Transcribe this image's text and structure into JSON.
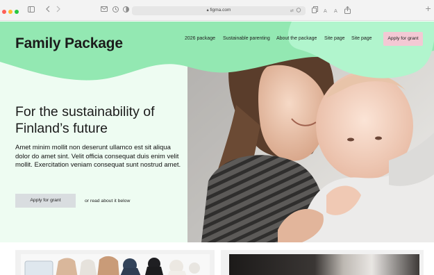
{
  "browser": {
    "url": "figma.com",
    "toolbar_icons": [
      "sidebar-icon",
      "back-icon",
      "forward-icon",
      "mail-icon",
      "history-icon",
      "shield-icon",
      "translate-icon",
      "copy-icon",
      "text-size-icon",
      "share-icon",
      "new-tab-icon"
    ],
    "text_small": "A",
    "text_large": "A",
    "new_tab": "+"
  },
  "site": {
    "logo": "Family Package",
    "nav": [
      "2026 package",
      "Sustainable parenting",
      "About the package",
      "Site page",
      "Site page"
    ],
    "apply_top": "Apply for grant",
    "headline": "For the sustainability of Finland’s future",
    "body": "Amet minim mollit non deserunt ullamco est sit aliqua dolor do amet sint. Velit officia consequat duis enim velit mollit. Exercitation veniam consequat sunt nostrud amet.",
    "apply_button": "Apply for grant",
    "read_link": "or read about it below"
  },
  "colors": {
    "mint_light": "#eefcf2",
    "mint_band": "#93e8b2",
    "mint_blob": "#b1f5cd",
    "pink_button": "#f3c9d4",
    "gray_button": "#d9dde0"
  }
}
